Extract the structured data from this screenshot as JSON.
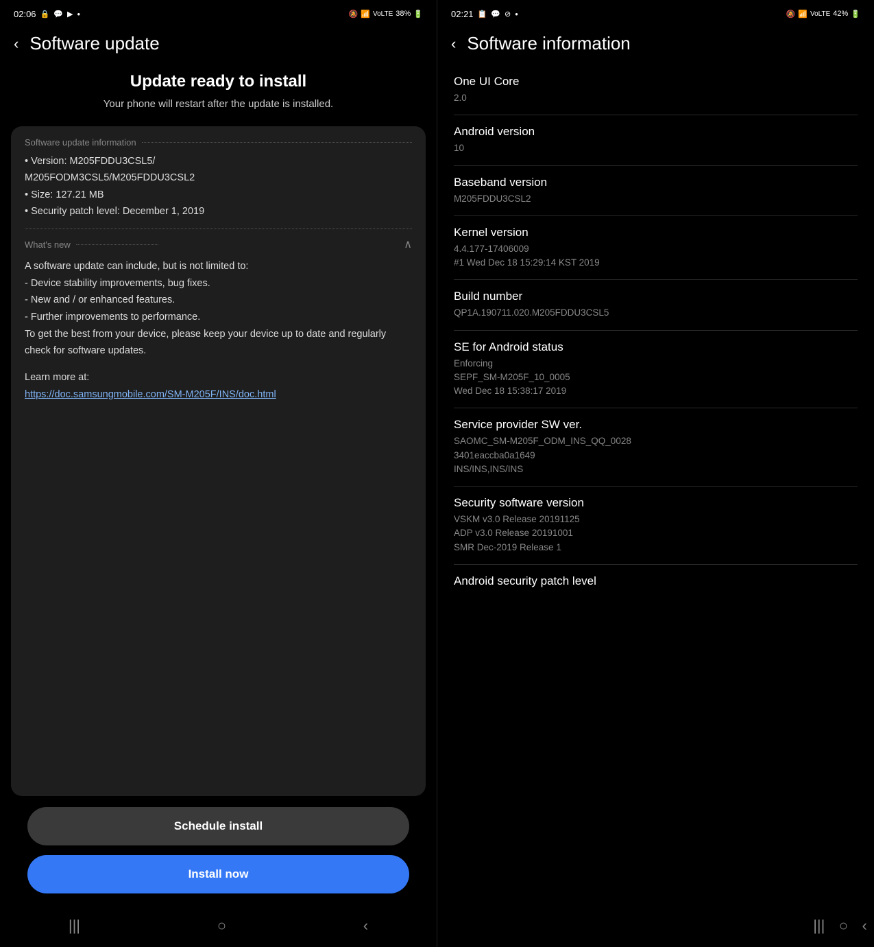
{
  "leftPanel": {
    "statusBar": {
      "time": "02:06",
      "battery": "38%",
      "icons": "🔕 📶 VoLTE"
    },
    "header": {
      "backLabel": "‹",
      "title": "Software update"
    },
    "updateHeading": {
      "title": "Update ready to install",
      "subtitle": "Your phone will restart after the update is installed."
    },
    "infoCard": {
      "sectionLabel": "Software update information",
      "version": "• Version: M205FDDU3CSL5/\n  M205FODM3CSL5/M205FDDU3CSL2",
      "size": "• Size: 127.21 MB",
      "security": "• Security patch level: December 1, 2019",
      "whatsNewLabel": "What's new",
      "whatsNewText": "A software update can include, but is not limited to:\n - Device stability improvements, bug fixes.\n - New and / or enhanced features.\n - Further improvements to performance.\nTo get the best from your device, please keep your device up to date and regularly check for software updates.",
      "learnMoreLabel": "Learn more at:",
      "learnMoreLink": "https://doc.samsungmobile.com/SM-M205F/INS/doc.html"
    },
    "buttons": {
      "schedule": "Schedule install",
      "install": "Install now"
    },
    "navBar": {
      "menu": "|||",
      "home": "○",
      "back": "‹"
    }
  },
  "rightPanel": {
    "statusBar": {
      "time": "02:21",
      "battery": "42%"
    },
    "header": {
      "backLabel": "‹",
      "title": "Software information"
    },
    "infoRows": [
      {
        "title": "One UI Core",
        "value": "2.0"
      },
      {
        "title": "Android version",
        "value": "10"
      },
      {
        "title": "Baseband version",
        "value": "M205FDDU3CSL2"
      },
      {
        "title": "Kernel version",
        "value": "4.4.177-17406009\n#1 Wed Dec 18 15:29:14 KST 2019"
      },
      {
        "title": "Build number",
        "value": "QP1A.190711.020.M205FDDU3CSL5"
      },
      {
        "title": "SE for Android status",
        "value": "Enforcing\nSEPF_SM-M205F_10_0005\nWed Dec 18 15:38:17 2019"
      },
      {
        "title": "Service provider SW ver.",
        "value": "SAOMC_SM-M205F_ODM_INS_QQ_0028\n3401eaccba0a1649\nINS/INS,INS/INS"
      },
      {
        "title": "Security software version",
        "value": "VSKM v3.0 Release 20191125\nADP v3.0 Release 20191001\nSMR Dec-2019 Release 1"
      },
      {
        "title": "Android security patch level",
        "value": ""
      }
    ],
    "navBar": {
      "menu": "|||",
      "home": "○",
      "back": "‹"
    }
  }
}
